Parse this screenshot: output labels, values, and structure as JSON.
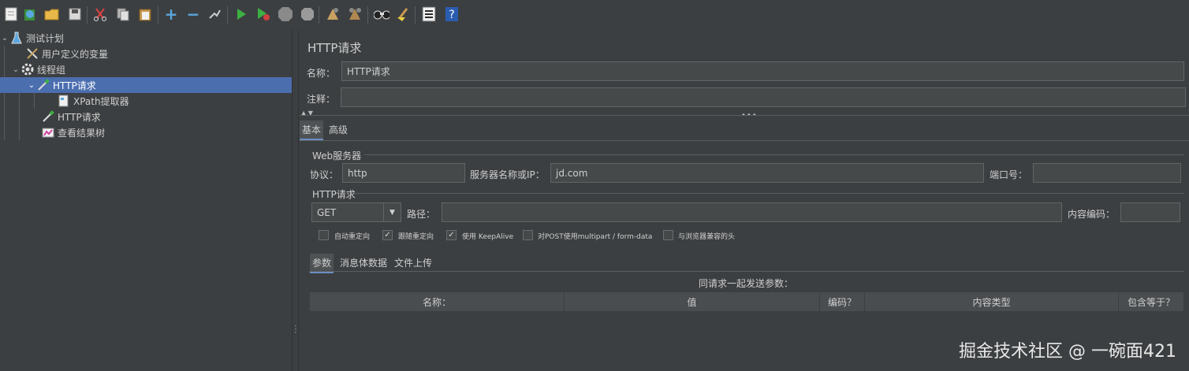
{
  "toolbar": {
    "icons": [
      "new-icon",
      "templates-icon",
      "open-icon",
      "save-icon",
      "cut-icon",
      "copy-icon",
      "paste-icon",
      "expand-icon",
      "collapse-icon",
      "toggle-icon",
      "start-icon",
      "start-no-pause-icon",
      "stop-icon",
      "shutdown-icon",
      "clear-icon",
      "clear-all-icon",
      "search-icon",
      "reset-search-icon",
      "function-helper-icon",
      "help-icon"
    ]
  },
  "tree": {
    "items": [
      {
        "label": "测试计划",
        "icon": "flask-icon"
      },
      {
        "label": "用户定义的变量",
        "icon": "tools-icon"
      },
      {
        "label": "线程组",
        "icon": "gear-icon"
      },
      {
        "label": "HTTP请求",
        "icon": "pipette-icon"
      },
      {
        "label": "XPath提取器",
        "icon": "document-icon"
      },
      {
        "label": "HTTP请求",
        "icon": "pipette-icon"
      },
      {
        "label": "查看结果树",
        "icon": "chart-icon"
      }
    ]
  },
  "main": {
    "title": "HTTP请求",
    "name_label": "名称：",
    "name_value": "HTTP请求",
    "comment_label": "注释：",
    "comment_value": "",
    "tabs": [
      {
        "label": "基本"
      },
      {
        "label": "高级"
      }
    ],
    "web_server": {
      "group_title": "Web服务器",
      "protocol_label": "协议：",
      "protocol_value": "http",
      "server_label": "服务器名称或IP：",
      "server_value": "jd.com",
      "port_label": "端口号：",
      "port_value": ""
    },
    "http_request": {
      "group_title": "HTTP请求",
      "method_value": "GET",
      "path_label": "路径：",
      "path_value": "",
      "encoding_label": "内容编码：",
      "encoding_value": ""
    },
    "checkboxes": [
      {
        "label": "自动重定向",
        "checked": false
      },
      {
        "label": "跟随重定向",
        "checked": true
      },
      {
        "label": "使用 KeepAlive",
        "checked": true
      },
      {
        "label": "对POST使用multipart / form-data",
        "checked": false
      },
      {
        "label": "与浏览器兼容的头",
        "checked": false
      }
    ],
    "sub_tabs": [
      {
        "label": "参数"
      },
      {
        "label": "消息体数据"
      },
      {
        "label": "文件上传"
      }
    ],
    "params_caption": "同请求一起发送参数：",
    "table_headers": [
      "名称：",
      "值",
      "编码？",
      "内容类型",
      "包含等于？"
    ]
  },
  "watermark": "掘金技术社区 @ 一碗面421",
  "colors": {
    "background": "#3c3f41",
    "selected": "#4b6eaf",
    "field": "#45494a"
  }
}
